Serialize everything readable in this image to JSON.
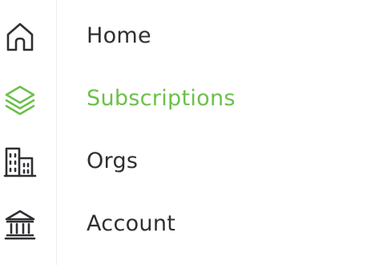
{
  "colors": {
    "text": "#2f2f33",
    "active": "#6cc04a",
    "divider": "#ececec"
  },
  "nav": {
    "items": [
      {
        "label": "Home",
        "icon": "home-icon",
        "active": false
      },
      {
        "label": "Subscriptions",
        "icon": "layers-icon",
        "active": true
      },
      {
        "label": "Orgs",
        "icon": "buildings-icon",
        "active": false
      },
      {
        "label": "Account",
        "icon": "bank-icon",
        "active": false
      }
    ]
  }
}
